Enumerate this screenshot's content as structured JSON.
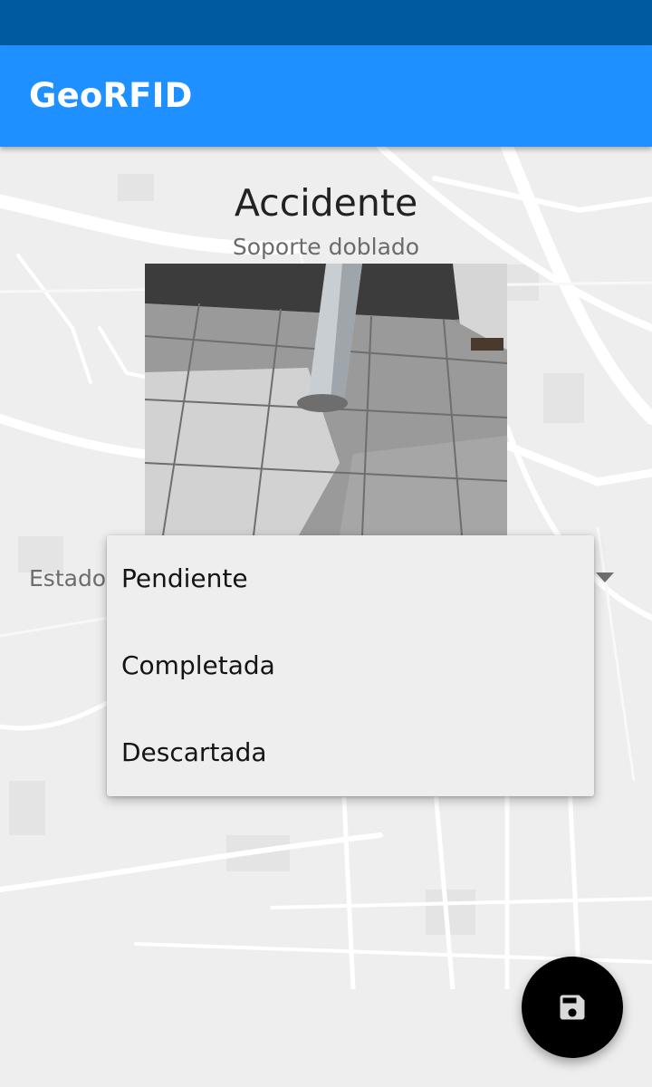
{
  "app": {
    "title": "GeoRFID"
  },
  "incident": {
    "title": "Accidente",
    "subtitle": "Soporte doblado"
  },
  "form": {
    "estado_label": "Estado",
    "estado_options": [
      "Pendiente",
      "Completada",
      "Descartada"
    ]
  },
  "fab": {
    "icon": "save-icon"
  },
  "colors": {
    "status_bar": "#005a9e",
    "app_bar": "#1e90ff",
    "background": "#eeeeee",
    "fab": "#000000"
  }
}
